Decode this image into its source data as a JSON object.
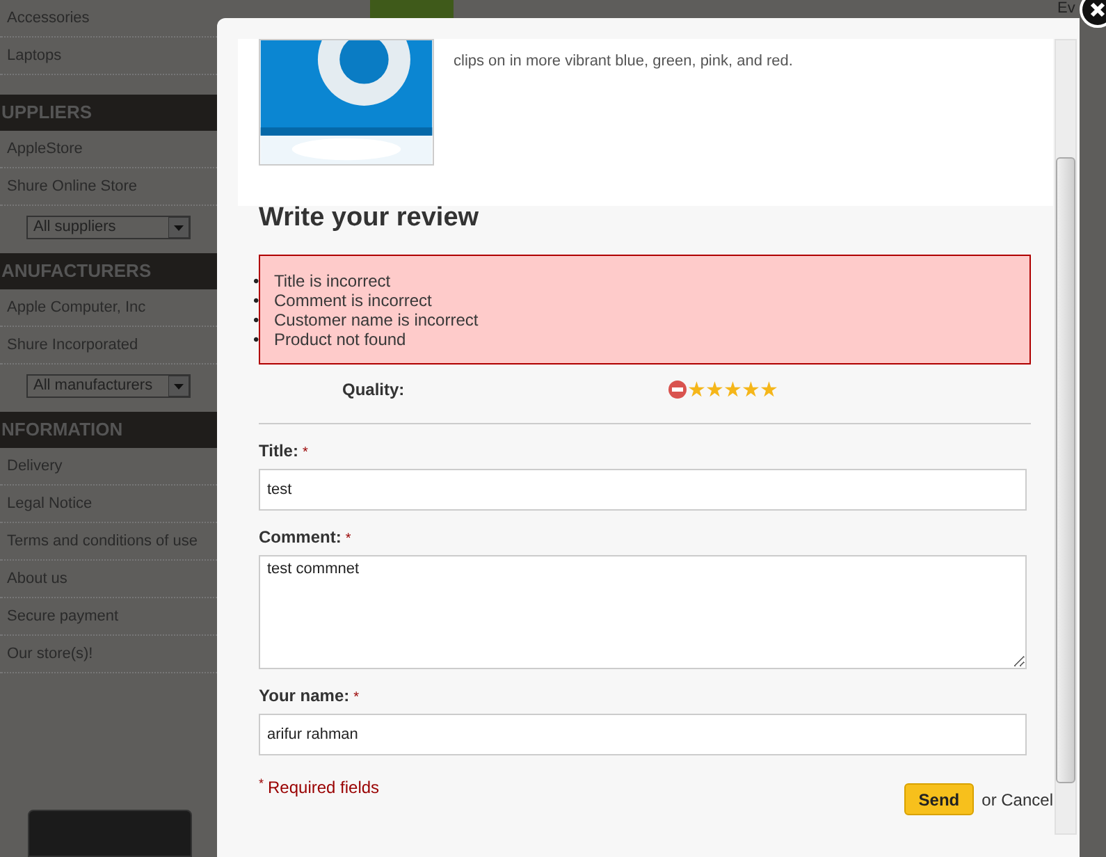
{
  "sidebar": {
    "categories": [
      {
        "label": "Accessories"
      },
      {
        "label": "Laptops"
      }
    ],
    "sections": [
      {
        "title": "UPPLIERS",
        "items": [
          "AppleStore",
          "Shure Online Store"
        ],
        "select": "All suppliers"
      },
      {
        "title": "ANUFACTURERS",
        "items": [
          "Apple Computer, Inc",
          "Shure Incorporated"
        ],
        "select": "All manufacturers"
      },
      {
        "title": "NFORMATION",
        "items": [
          "Delivery",
          "Legal Notice",
          "Terms and conditions of use",
          "About us",
          "Secure payment",
          "Our store(s)!"
        ]
      }
    ]
  },
  "background_fragment": "Ev",
  "modal": {
    "product_description": "clips on in more vibrant blue, green, pink, and red.",
    "heading": "Write your review",
    "errors": [
      {
        "marker": "•",
        "text": "Title is incorrect"
      },
      {
        "marker": "•",
        "text": "Comment is incorrect"
      },
      {
        "marker": "•",
        "text": "Customer name is incorrect"
      },
      {
        "marker": "•",
        "text": "Product not found"
      }
    ],
    "criterion": {
      "label": "Quality:",
      "stars": 5
    },
    "fields": [
      {
        "label": "Title:",
        "required_mark": "*",
        "kind": "input",
        "value": "test"
      },
      {
        "label": "Comment:",
        "required_mark": "*",
        "kind": "textarea",
        "value": "test commnet"
      },
      {
        "label": "Your name:",
        "required_mark": "*",
        "kind": "input",
        "value": "arifur rahman"
      }
    ],
    "required_note": {
      "mark": "*",
      "text": "Required fields"
    },
    "send_button": "Send",
    "cancel": "or Cancel"
  }
}
